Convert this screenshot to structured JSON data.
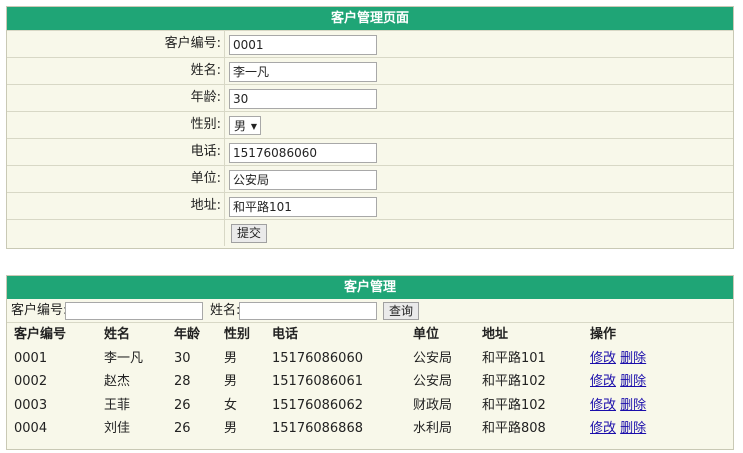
{
  "form": {
    "title": "客户管理页面",
    "fields": {
      "id": {
        "label": "客户编号:",
        "value": "0001"
      },
      "name": {
        "label": "姓名:",
        "value": "李一凡"
      },
      "age": {
        "label": "年龄:",
        "value": "30"
      },
      "gender": {
        "label": "性别:",
        "value": "男"
      },
      "phone": {
        "label": "电话:",
        "value": "15176086060"
      },
      "unit": {
        "label": "单位:",
        "value": "公安局"
      },
      "address": {
        "label": "地址:",
        "value": "和平路101"
      }
    },
    "submit_label": "提交"
  },
  "list": {
    "title": "客户管理",
    "search": {
      "id_label": "客户编号:",
      "name_label": "姓名:",
      "query_label": "查询"
    },
    "headers": [
      "客户编号",
      "姓名",
      "年龄",
      "性别",
      "电话",
      "单位",
      "地址",
      "操作"
    ],
    "edit_label": "修改",
    "delete_label": "删除",
    "rows": [
      [
        "0001",
        "李一凡",
        "30",
        "男",
        "15176086060",
        "公安局",
        "和平路101"
      ],
      [
        "0002",
        "赵杰",
        "28",
        "男",
        "15176086061",
        "公安局",
        "和平路102"
      ],
      [
        "0003",
        "王菲",
        "26",
        "女",
        "15176086062",
        "财政局",
        "和平路102"
      ],
      [
        "0004",
        "刘佳",
        "26",
        "男",
        "15176086868",
        "水利局",
        "和平路808"
      ]
    ]
  },
  "colors": {
    "header_green": "#1fa576",
    "panel_bg": "#f8f8ea",
    "link_blue": "#1a0dab"
  }
}
